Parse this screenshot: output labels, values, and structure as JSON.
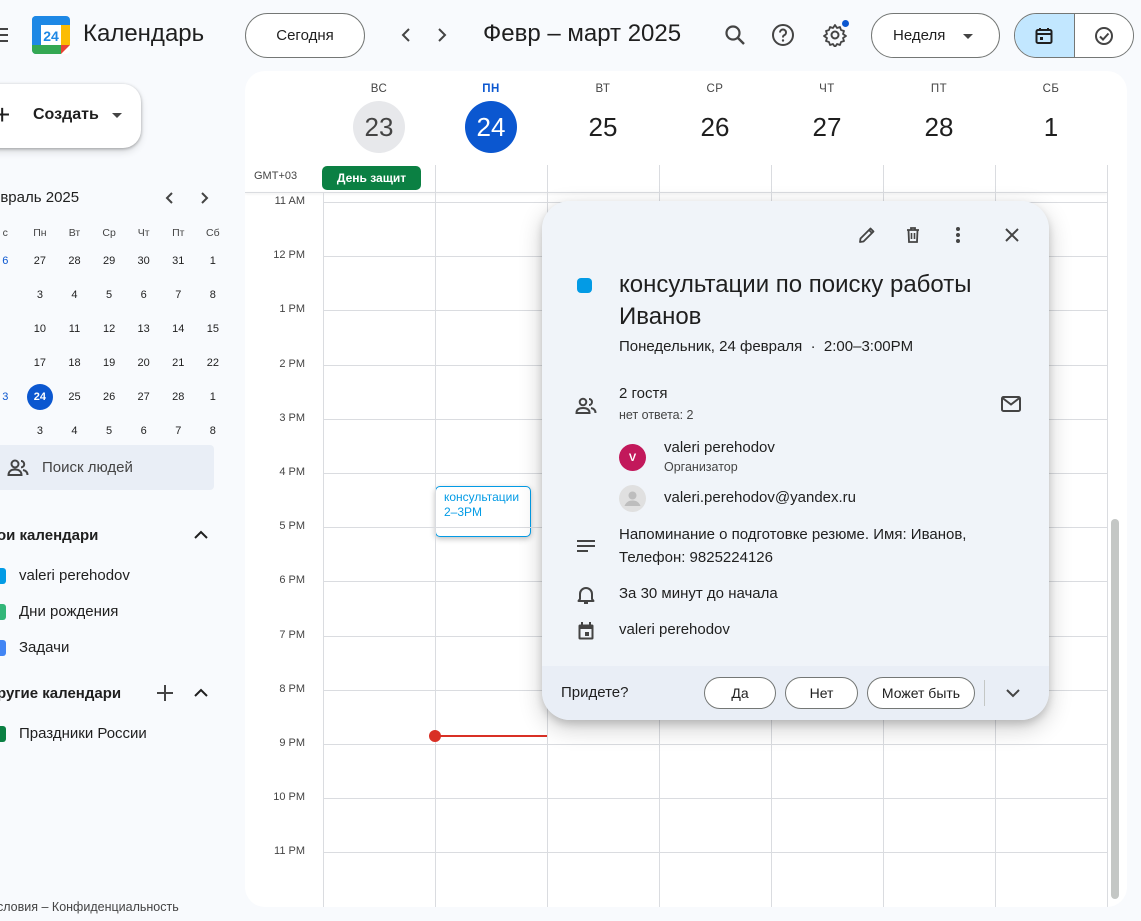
{
  "header": {
    "app_title": "Календарь",
    "logo_number": "24",
    "today_label": "Сегодня",
    "period": "Февр – март 2025",
    "view_label": "Неделя",
    "icons": [
      "menu-icon",
      "search-icon",
      "help-icon",
      "settings-icon",
      "calendar-view-icon",
      "tasks-view-icon"
    ]
  },
  "sidebar": {
    "create_label": "Создать",
    "mini_calendar": {
      "month_label": "евраль 2025",
      "weekdays": [
        "с",
        "Пн",
        "Вт",
        "Ср",
        "Чт",
        "Пт",
        "Сб"
      ],
      "weeks": [
        [
          "6",
          "27",
          "28",
          "29",
          "30",
          "31",
          "1"
        ],
        [
          "",
          "3",
          "4",
          "5",
          "6",
          "7",
          "8"
        ],
        [
          "",
          "10",
          "11",
          "12",
          "13",
          "14",
          "15"
        ],
        [
          "",
          "17",
          "18",
          "19",
          "20",
          "21",
          "22"
        ],
        [
          "3",
          "24",
          "25",
          "26",
          "27",
          "28",
          "1"
        ],
        [
          "",
          "3",
          "4",
          "5",
          "6",
          "7",
          "8"
        ]
      ],
      "today": "24"
    },
    "search_people": "Поиск людей",
    "my_calendars_title": "ои календари",
    "my_calendars": [
      {
        "label": "valeri perehodov",
        "color": "#039be5"
      },
      {
        "label": "Дни рождения",
        "color": "#33b679"
      },
      {
        "label": "Задачи",
        "color": "#4285f4"
      }
    ],
    "other_calendars_title": "ругие календари",
    "other_calendars": [
      {
        "label": "Праздники России",
        "color": "#0b8043"
      }
    ],
    "footer": "словия – Конфиденциальность"
  },
  "week": {
    "days": [
      {
        "dow": "ВС",
        "num": "23",
        "state": "past"
      },
      {
        "dow": "ПН",
        "num": "24",
        "state": "today"
      },
      {
        "dow": "ВТ",
        "num": "25",
        "state": "future"
      },
      {
        "dow": "СР",
        "num": "26",
        "state": "future"
      },
      {
        "dow": "ЧТ",
        "num": "27",
        "state": "future"
      },
      {
        "dow": "ПТ",
        "num": "28",
        "state": "future"
      },
      {
        "dow": "СБ",
        "num": "1",
        "state": "future"
      }
    ],
    "timezone": "GMT+03",
    "allday_event": "День защит",
    "hours": [
      "11 AM",
      "12 PM",
      "1 PM",
      "2 PM",
      "3 PM",
      "4 PM",
      "5 PM",
      "6 PM",
      "7 PM",
      "8 PM",
      "9 PM",
      "10 PM",
      "11 PM"
    ],
    "event": {
      "title": "консультации",
      "time": "2–3PM",
      "color": "#039be5"
    },
    "now_color": "#d93025"
  },
  "popup": {
    "title": "консультации по поиску работы Иванов",
    "when_date": "Понедельник, 24 февраля",
    "when_sep": "·",
    "when_time": "2:00–3:00PM",
    "guests_count": "2 гостя",
    "guests_status": "нет ответа: 2",
    "guests": [
      {
        "initial": "V",
        "name": "valeri perehodov",
        "role": "Организатор",
        "color": "#c2185b"
      },
      {
        "initial": "",
        "name": "valeri.perehodov@yandex.ru",
        "role": "",
        "color": "#e0e0e0"
      }
    ],
    "description": "Напоминание о подготовке резюме. Имя: Иванов, Телефон: 9825224126",
    "reminder": "За 30 минут до начала",
    "calendar": "valeri perehodov",
    "rsvp_question": "Придете?",
    "rsvp_yes": "Да",
    "rsvp_no": "Нет",
    "rsvp_maybe": "Может быть"
  }
}
